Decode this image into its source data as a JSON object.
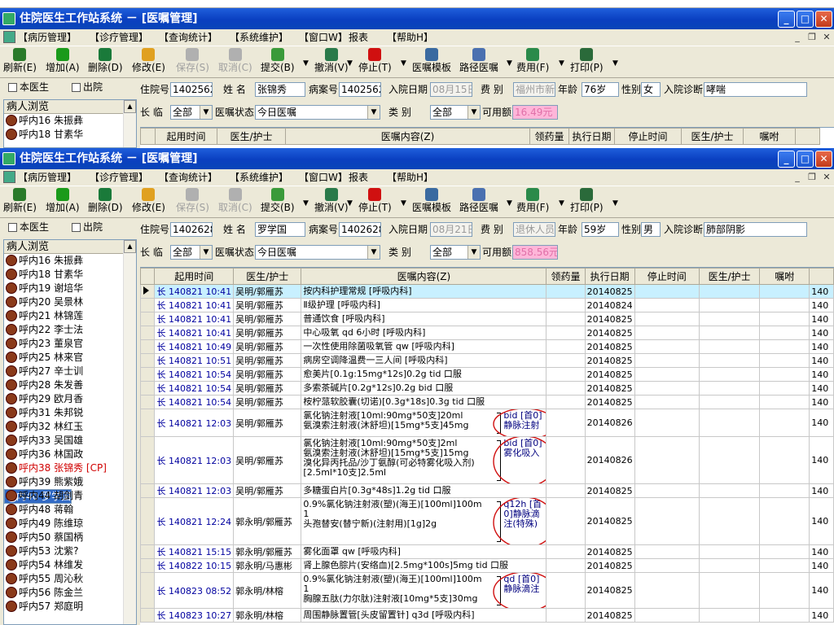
{
  "window1": {
    "title": "住院医生工作站系统 － [医嘱管理]",
    "patient": {
      "admit_no": "1402562",
      "name": "张锦秀",
      "case_no": "1402562",
      "admit_date": "08月15日",
      "fee_type": "福州市新",
      "age": "76岁",
      "sex": "女",
      "diagnosis": "哮喘"
    },
    "filter": {
      "long_temp": "全部",
      "status": "今日医嘱",
      "category": "全部",
      "balance": "16.49元"
    },
    "patients": [
      {
        "text": "呼内16  朱振彝"
      },
      {
        "text": "呼内18  甘素华"
      }
    ]
  },
  "window2": {
    "title": "住院医生工作站系统 － [医嘱管理]",
    "patient": {
      "admit_no": "1402628",
      "name": "罗学国",
      "case_no": "1402628",
      "admit_date": "08月21日",
      "fee_type": "退休人员",
      "age": "59岁",
      "sex": "男",
      "diagnosis": "肺部阴影"
    },
    "filter": {
      "long_temp": "全部",
      "status": "今日医嘱",
      "category": "全部",
      "balance": "858.56元"
    },
    "patients": [
      {
        "text": "呼内16  朱振彝",
        "style": ""
      },
      {
        "text": "呼内18  甘素华",
        "style": ""
      },
      {
        "text": "呼内19  谢培华",
        "style": ""
      },
      {
        "text": "呼内20  吴景林",
        "style": ""
      },
      {
        "text": "呼内21  林锦莲",
        "style": ""
      },
      {
        "text": "呼内22  李士法",
        "style": ""
      },
      {
        "text": "呼内23  董泉官",
        "style": ""
      },
      {
        "text": "呼内25  林来官",
        "style": ""
      },
      {
        "text": "呼内27  辛士训",
        "style": ""
      },
      {
        "text": "呼内28  朱发善",
        "style": ""
      },
      {
        "text": "呼内29  欧月香",
        "style": ""
      },
      {
        "text": "呼内31  朱邦锐",
        "style": ""
      },
      {
        "text": "呼内32  林红玉",
        "style": ""
      },
      {
        "text": "呼内33  吴国雄",
        "style": ""
      },
      {
        "text": "呼内36  林国政",
        "style": ""
      },
      {
        "text": "呼内38  张锦秀 [CP]",
        "style": "red"
      },
      {
        "text": "呼内39  熊紫娥",
        "style": ""
      },
      {
        "text": "呼内40  罗学国",
        "style": "sel"
      },
      {
        "text": "呼内44  胡剑青",
        "style": ""
      },
      {
        "text": "呼内48  蒋翰",
        "style": ""
      },
      {
        "text": "呼内49  陈维琼",
        "style": ""
      },
      {
        "text": "呼内50  蔡国柄",
        "style": ""
      },
      {
        "text": "呼内53  沈紫?",
        "style": ""
      },
      {
        "text": "呼内54  林维发",
        "style": ""
      },
      {
        "text": "呼内55  周沁秋",
        "style": ""
      },
      {
        "text": "呼内56  陈金兰",
        "style": ""
      },
      {
        "text": "呼内57  郑庭明",
        "style": ""
      }
    ],
    "orders": [
      {
        "k": "长",
        "start": "140821 10:41",
        "doc": "吴明/郭雁苏",
        "content": [
          "按内科护理常规   [呼吸内科]"
        ],
        "exec": "20140825",
        "extra": "140"
      },
      {
        "k": "长",
        "start": "140821 10:41",
        "doc": "吴明/郭雁苏",
        "content": [
          "Ⅱ级护理   [呼吸内科]"
        ],
        "exec": "20140824",
        "extra": "140"
      },
      {
        "k": "长",
        "start": "140821 10:41",
        "doc": "吴明/郭雁苏",
        "content": [
          "普通饮食   [呼吸内科]"
        ],
        "exec": "20140825",
        "extra": "140"
      },
      {
        "k": "长",
        "start": "140821 10:41",
        "doc": "吴明/郭雁苏",
        "content": [
          "中心吸氧 qd 6小时  [呼吸内科]"
        ],
        "exec": "20140825",
        "extra": "140"
      },
      {
        "k": "长",
        "start": "140821 10:49",
        "doc": "吴明/郭雁苏",
        "content": [
          "一次性使用除菌吸氧管 qw  [呼吸内科]"
        ],
        "exec": "20140825",
        "extra": "140"
      },
      {
        "k": "长",
        "start": "140821 10:51",
        "doc": "吴明/郭雁苏",
        "content": [
          "病房空调降温费一三人间   [呼吸内科]"
        ],
        "exec": "20140825",
        "extra": "140"
      },
      {
        "k": "长",
        "start": "140821 10:54",
        "doc": "吴明/郭雁苏",
        "content": [
          "愈美片[0.1g:15mg*12s]0.2g tid 口服"
        ],
        "exec": "20140825",
        "extra": "140"
      },
      {
        "k": "长",
        "start": "140821 10:54",
        "doc": "吴明/郭雁苏",
        "content": [
          "多索茶碱片[0.2g*12s]0.2g bid 口服"
        ],
        "exec": "20140825",
        "extra": "140"
      },
      {
        "k": "长",
        "start": "140821 10:54",
        "doc": "吴明/郭雁苏",
        "content": [
          "桉柠蒎软胶囊(切诺)[0.3g*18s]0.3g tid 口服"
        ],
        "exec": "20140825",
        "extra": "140"
      },
      {
        "k": "长",
        "start": "140821 12:03",
        "doc": "吴明/郭雁苏",
        "content": [
          "氯化钠注射液[10ml:90mg*50支]20ml",
          "氨溴索注射液(沐舒坦)[15mg*5支]45mg"
        ],
        "bracket": "bid [首0]静脉注射",
        "exec": "20140826",
        "extra": "140",
        "tall": 34
      },
      {
        "k": "长",
        "start": "140821 12:03",
        "doc": "吴明/郭雁苏",
        "content": [
          "氯化钠注射液[10ml:90mg*50支]2ml",
          "氨溴索注射液(沐舒坦)[15mg*5支]15mg",
          "溴化异丙托品/沙丁氨醇(可必特雾化吸入剂)",
          "[2.5ml*10支]2.5ml"
        ],
        "bracket": "bid [首0]雾化吸入",
        "exec": "20140826",
        "extra": "140",
        "tall": 58
      },
      {
        "k": "长",
        "start": "140821 12:03",
        "doc": "吴明/郭雁苏",
        "content": [
          "多糖蛋白片[0.3g*48s]1.2g tid 口服"
        ],
        "exec": "20140825",
        "extra": "140"
      },
      {
        "k": "长",
        "start": "140821 12:24",
        "doc": "郭永明/郭雁苏",
        "content": [
          "0.9%氯化钠注射液(塑)(海王)[100ml]100m",
          "1",
          "头孢替安(替宁新)(注射用)[1g]2g"
        ],
        "bracket": "q12h [首0]静脉滴注(特殊)",
        "exec": "20140825",
        "extra": "140",
        "tall": 58
      },
      {
        "k": "长",
        "start": "140821 15:15",
        "doc": "郭永明/郭雁苏",
        "content": [
          "雾化面罩 qw  [呼吸内科]"
        ],
        "exec": "20140825",
        "extra": "140"
      },
      {
        "k": "长",
        "start": "140822 10:15",
        "doc": "郭永明/马惠彬",
        "content": [
          "肾上腺色腙片(安络血)[2.5mg*100s]5mg tid 口服"
        ],
        "exec": "20140825",
        "extra": "140"
      },
      {
        "k": "长",
        "start": "140823 08:52",
        "doc": "郭永明/林榕",
        "content": [
          "0.9%氯化钠注射液(塑)(海王)[100ml]100m",
          "1",
          "胸腺五肽(力尔肽)注射液[10mg*5支]30mg"
        ],
        "bracket": "qd [首0]静脉滴注",
        "exec": "20140825",
        "extra": "140",
        "tall": 44
      },
      {
        "k": "长",
        "start": "140823 10:27",
        "doc": "郭永明/林榕",
        "content": [
          "周围静脉置管[头皮留置针] q3d  [呼吸内科]"
        ],
        "exec": "20140825",
        "extra": "140"
      }
    ]
  },
  "menu": [
    "【病历管理】",
    "【诊疗管理】",
    "【查询统计】",
    "【系统维护】",
    "【窗口W】",
    "报表",
    "【帮助H】"
  ],
  "toolbar": [
    {
      "label": "刷新(E)",
      "icon": "refresh-icon",
      "color": "#2a7a2a",
      "dis": false
    },
    {
      "label": "增加(A)",
      "icon": "add-icon",
      "color": "#1a9a1a",
      "dis": false
    },
    {
      "label": "删除(D)",
      "icon": "delete-icon",
      "color": "#1a7a3a",
      "dis": false
    },
    {
      "label": "修改(E)",
      "icon": "edit-icon",
      "color": "#e0a020",
      "dis": false
    },
    {
      "label": "保存(S)",
      "icon": "save-icon",
      "color": "#b0b0b0",
      "dis": true
    },
    {
      "label": "取消(C)",
      "icon": "cancel-icon",
      "color": "#b0b0b0",
      "dis": true
    },
    {
      "label": "提交(B)",
      "icon": "submit-icon",
      "color": "#3a9a3a",
      "dis": false
    },
    {
      "label": "撤消(V)",
      "icon": "undo-icon",
      "color": "#2a7a4a",
      "dis": false
    },
    {
      "label": "停止(T)",
      "icon": "stop-icon",
      "color": "#d01010",
      "dis": false
    },
    {
      "label": "医嘱模板",
      "icon": "template-icon",
      "color": "#3a6aa0",
      "dis": false
    },
    {
      "label": "路径医嘱",
      "icon": "path-order-icon",
      "color": "#4a70b0",
      "dis": false
    },
    {
      "label": "费用(F)",
      "icon": "fee-icon",
      "color": "#2a8a4a",
      "dis": false
    },
    {
      "label": "打印(P)",
      "icon": "print-icon",
      "color": "#2a6a3a",
      "dis": false
    }
  ],
  "labels": {
    "my_doctor": "本医生",
    "discharge": "出院",
    "patient_browse": "病人浏览",
    "admit_no": "住院号",
    "name": "姓  名",
    "case_no": "病案号",
    "admit_date": "入院日期",
    "fee_type": "费  别",
    "age": "年龄",
    "sex": "性别",
    "diagnosis": "入院诊断",
    "long_temp": "长  临",
    "status": "医嘱状态",
    "category": "类    别",
    "balance": "可用额"
  },
  "columns": [
    "起用时间",
    "医生/护士",
    "医嘱内容(Z)",
    "领药量",
    "执行日期",
    "停止时间",
    "医生/护士",
    "嘱咐"
  ]
}
